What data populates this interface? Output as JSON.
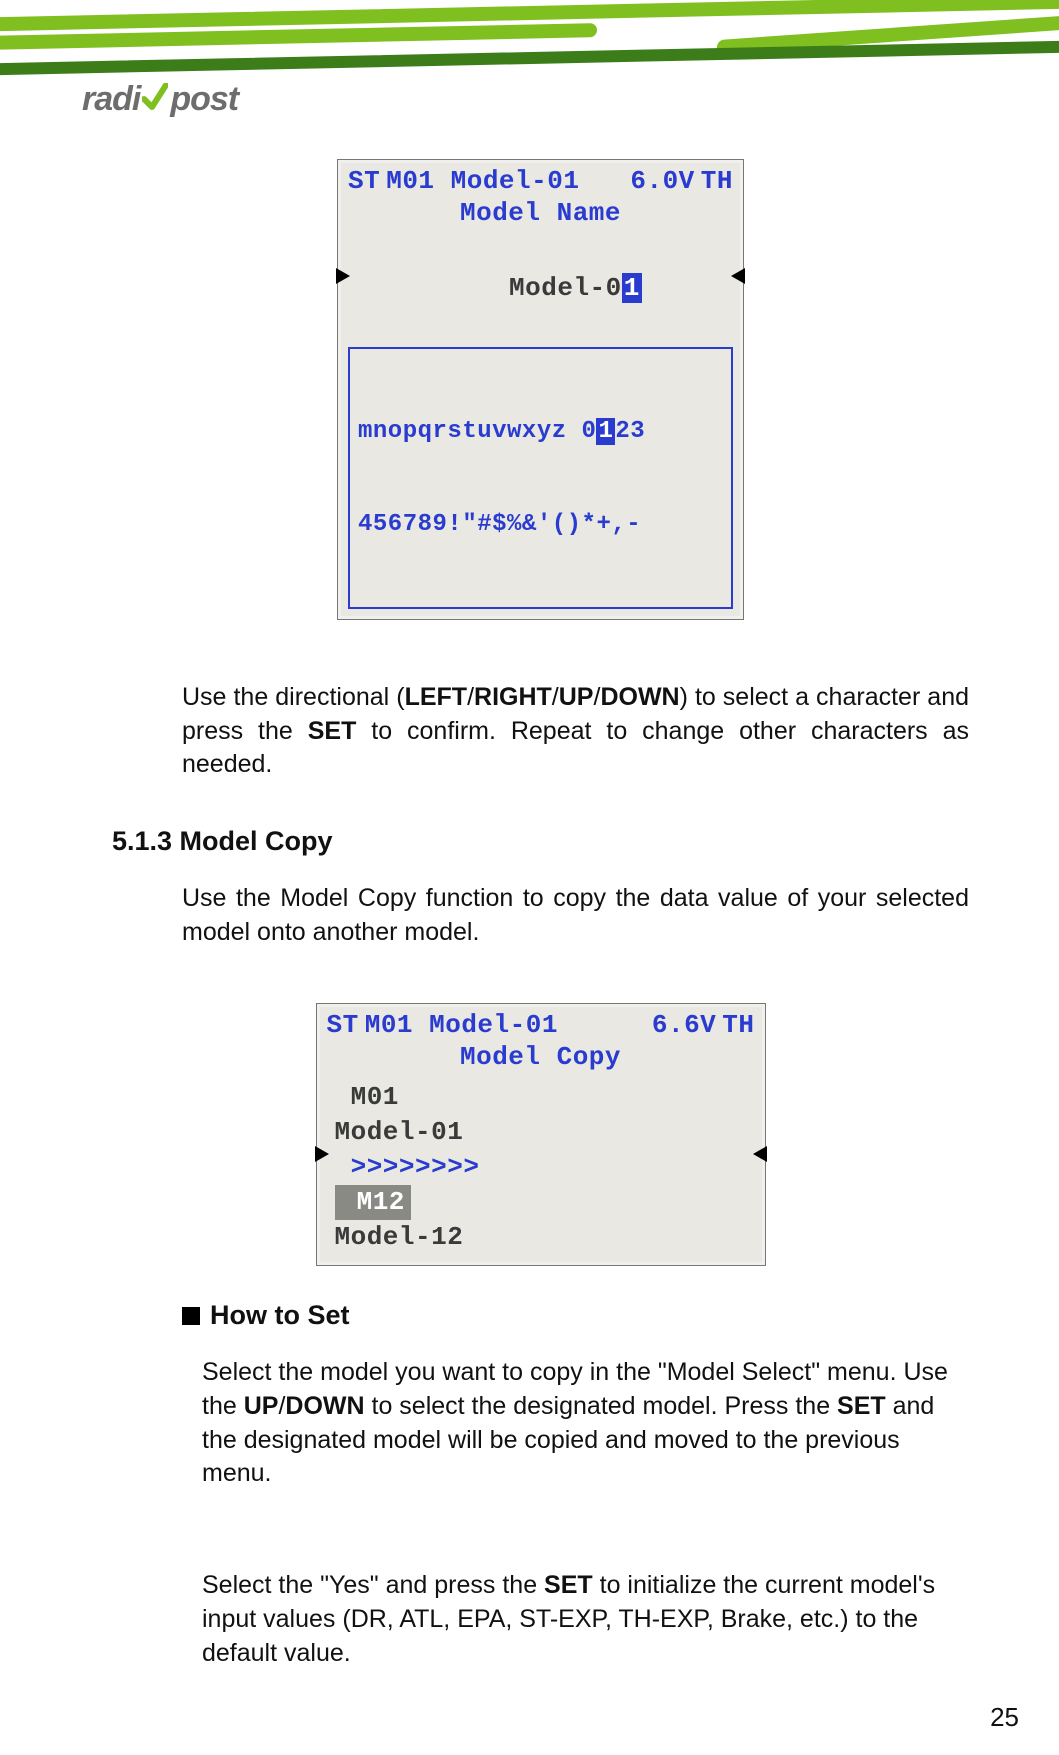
{
  "logo": {
    "left": "radi",
    "right": "post"
  },
  "lcd1": {
    "st": "ST",
    "th": "TH",
    "header": "M01 Model-01",
    "voltage": "6.0V",
    "title": "Model  Name",
    "name_pre": "Model-0",
    "name_hl": "1",
    "strip_line1_a": "mnopqrstuvwxyz 0",
    "strip_line1_hl": "1",
    "strip_line1_b": "23",
    "strip_line2": "456789!\"#$%&'()*+,-"
  },
  "para1": {
    "t1": "Use the directional (",
    "b1": "LEFT",
    "s1": "/",
    "b2": "RIGHT",
    "s2": "/",
    "b3": "UP",
    "s3": "/",
    "b4": "DOWN",
    "t2": ") to select a character and press the ",
    "b5": "SET",
    "t3": " to confirm.  Repeat to change other characters as needed."
  },
  "section": {
    "num_title": "5.1.3 Model Copy"
  },
  "para2": "Use the Model Copy function to copy the data value of your selected model onto another model.",
  "lcd2": {
    "st": "ST",
    "th": "TH",
    "header": "M01 Model-01",
    "voltage": "6.6V",
    "title": "Model  Copy",
    "r1": " M01",
    "r2": "Model-01",
    "r3": " >>>>>>>>",
    "r4": " M12",
    "r5": "Model-12"
  },
  "howto": {
    "title": "How to Set"
  },
  "para3": {
    "t1": "Select the model you want to copy in the \"Model Select\" menu.  Use the ",
    "b1": "UP",
    "s1": "/",
    "b2": "DOWN",
    "t2": " to select the designated model.  Press the ",
    "b3": "SET",
    "t3": " and the designated model will be copied and moved to the previous menu."
  },
  "para4": {
    "t1": "Select the \"Yes\" and press the ",
    "b1": "SET",
    "t2": " to initialize the current model's input values (DR, ATL, EPA, ST-EXP, TH-EXP, Brake, etc.) to the default value."
  },
  "page_number": "25"
}
